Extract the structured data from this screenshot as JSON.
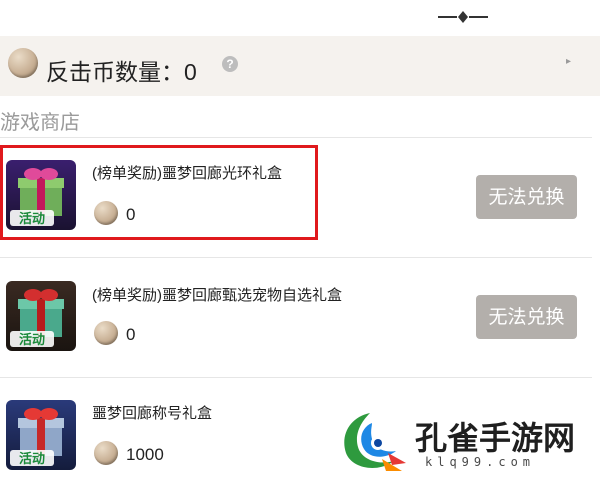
{
  "coin_bar": {
    "label": "反击币数量：0",
    "help_glyph": "?",
    "arrow_glyph": "▸"
  },
  "shop": {
    "title": "游戏商店"
  },
  "items": [
    {
      "name": "(榜单奖励)噩梦回廊光环礼盒",
      "price": "0",
      "button": "无法兑换",
      "icon_label": "活动"
    },
    {
      "name": "(榜单奖励)噩梦回廊甄选宠物自选礼盒",
      "price": "0",
      "button": "无法兑换",
      "icon_label": "活动"
    },
    {
      "name": "噩梦回廊称号礼盒",
      "price": "1000",
      "icon_label": "活动"
    }
  ],
  "watermark": {
    "text": "孔雀手游网",
    "url": "klq99.com"
  }
}
